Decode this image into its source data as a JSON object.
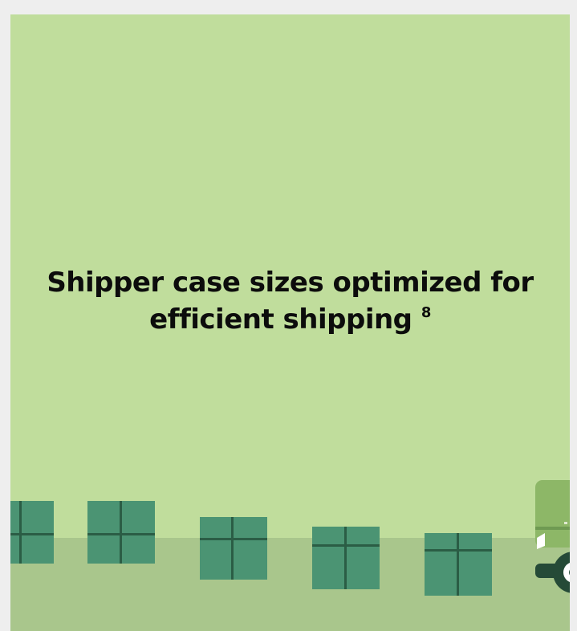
{
  "headline": {
    "line1": "Shipper case sizes optimized for",
    "line2": "efficient shipping",
    "footnote": "8"
  },
  "colors": {
    "page_background": "#eeeeee",
    "panel_green": "#c0dd9c",
    "ground_green": "#a9c68c",
    "box_green": "#4b9473",
    "box_tape": "#2b5d45",
    "truck_body": "#8db767",
    "truck_dark": "#254a37"
  },
  "illustration": {
    "boxes": [
      "shipping-box",
      "shipping-box",
      "shipping-box",
      "shipping-box",
      "shipping-box"
    ],
    "vehicle": "delivery-truck"
  }
}
